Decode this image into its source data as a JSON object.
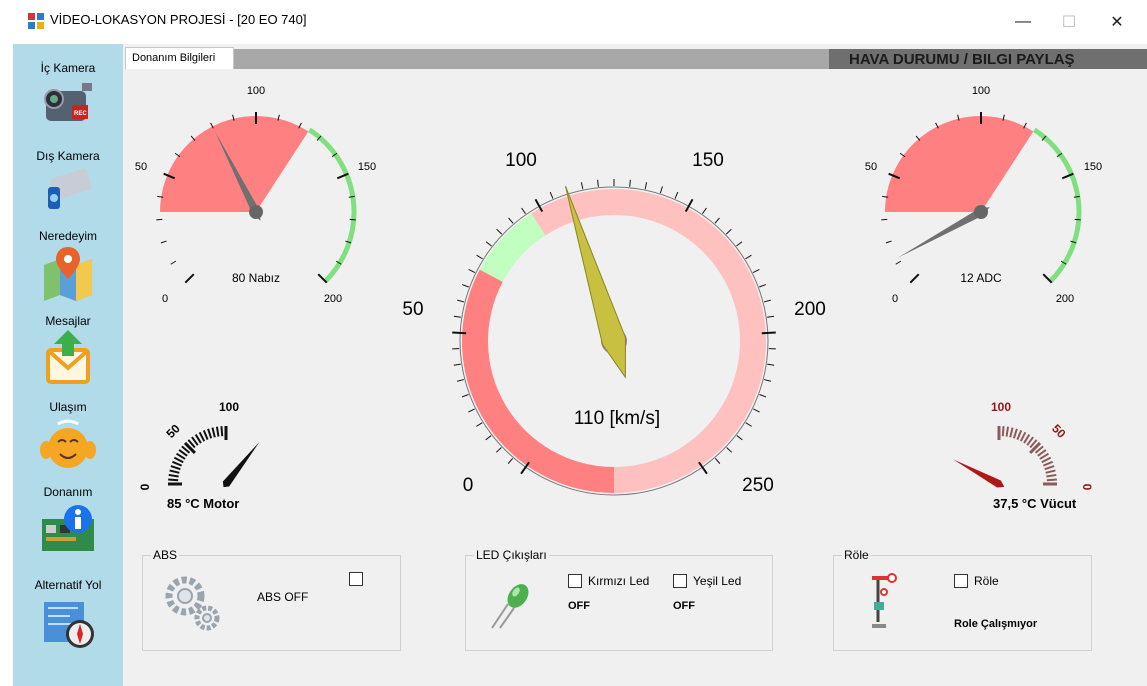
{
  "window": {
    "title": "VİDEO-LOKASYON PROJESİ - [20 EO 740]",
    "controls": {
      "minimize": "—",
      "maximize": "☐",
      "close": "✕"
    }
  },
  "sidebar": {
    "items": [
      {
        "label": "İç Kamera",
        "icon": "camcorder-icon"
      },
      {
        "label": "Dış Kamera",
        "icon": "security-camera-icon"
      },
      {
        "label": "Neredeyim",
        "icon": "map-pin-icon"
      },
      {
        "label": "Mesajlar",
        "icon": "mail-icon"
      },
      {
        "label": "Ulaşım",
        "icon": "smiley-icon"
      },
      {
        "label": "Donanım",
        "icon": "hardware-info-icon"
      },
      {
        "label": "Alternatif Yol",
        "icon": "map-compass-icon"
      }
    ]
  },
  "tabs": {
    "active": "Donanım Bilgileri"
  },
  "banner": "HAVA DURUMU / BILGI PAYLAŞ",
  "gauges": {
    "pulse": {
      "value": 80,
      "label": "80 Nabız",
      "ticks": [
        "0",
        "50",
        "100",
        "150",
        "200"
      ]
    },
    "speed": {
      "value": 110,
      "label": "110 [km/s]",
      "ticks": [
        "0",
        "50",
        "100",
        "150",
        "200",
        "250"
      ]
    },
    "adc": {
      "value": 12,
      "label": "12 ADC",
      "ticks": [
        "0",
        "50",
        "100",
        "150",
        "200"
      ]
    },
    "motor": {
      "value": 85,
      "label": "85 °C Motor",
      "ticks": [
        "0",
        "50",
        "100"
      ]
    },
    "body": {
      "value": 37.5,
      "label": "37,5 °C Vücut",
      "ticks": [
        "100",
        "50",
        "0"
      ]
    }
  },
  "groups": {
    "abs": {
      "title": "ABS",
      "status": "ABS OFF",
      "checked": false
    },
    "led": {
      "title": "LED Çıkışları",
      "red_label": "Kırmızı Led",
      "red_status": "OFF",
      "green_label": "Yeşil Led",
      "green_status": "OFF"
    },
    "relay": {
      "title": "Röle",
      "check_label": "Röle",
      "status": "Role Çalışmıyor"
    }
  },
  "colors": {
    "sidebar": "#b2dbea",
    "red_zone": "#ff8080",
    "pink_zone": "#ffc0c0",
    "green_zone": "#c0ffc0",
    "green_ring": "#80e080",
    "needle_yellow": "#c8c040"
  }
}
